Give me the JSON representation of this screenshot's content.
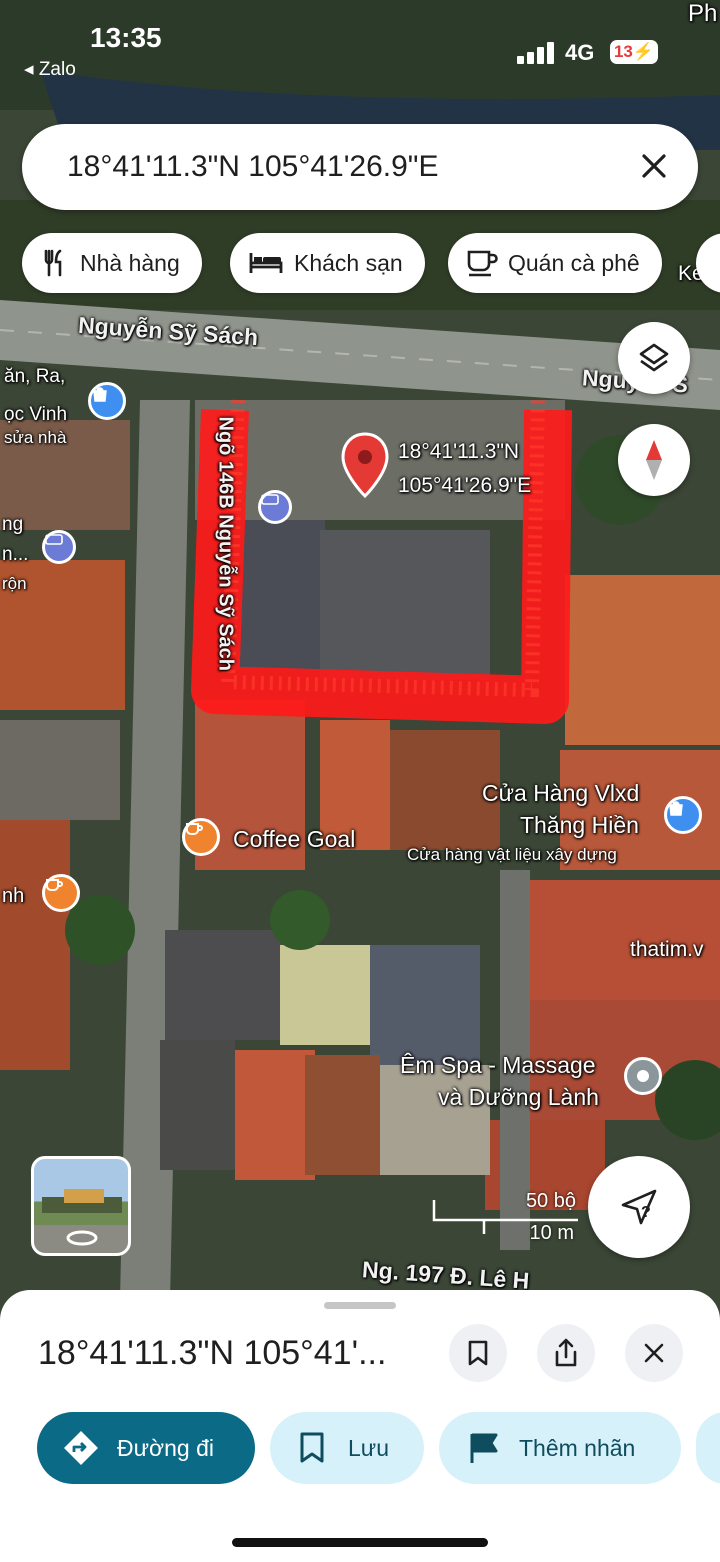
{
  "status_bar": {
    "time": "13:35",
    "back_app": "◂ Zalo",
    "network": "4G",
    "battery": "13",
    "battery_icon": "charging-battery-icon"
  },
  "search": {
    "query": "18°41'11.3\"N 105°41'26.9\"E",
    "clear_icon": "close-icon"
  },
  "chips": [
    {
      "label": "Nhà hàng",
      "icon": "restaurant-icon"
    },
    {
      "label": "Khách sạn",
      "icon": "hotel-bed-icon"
    },
    {
      "label": "Quán cà phê",
      "icon": "coffee-cup-icon"
    }
  ],
  "map": {
    "top_right_text": "Ph",
    "streets": {
      "main": "Nguyễn Sỹ Sách",
      "main_right": "Nguyễn S",
      "alley": "Ngõ 146B Nguyễn Sỹ Sách",
      "bottom": "Ng. 197 Đ. Lê H"
    },
    "pin": {
      "lat": "18°41'11.3\"N",
      "lng": "105°41'26.9\"E",
      "color": "#e53935"
    },
    "left_labels": [
      "ăn, Ra,",
      "ọc Vinh",
      "sửa nhà",
      "ng",
      "n...",
      "rộn",
      "nh"
    ],
    "pois": [
      {
        "name": "Coffee Goal",
        "type": "cafe"
      },
      {
        "name": "Cửa Hàng Vlxd",
        "name2": "Thăng Hiền",
        "subtitle": "Cửa hàng vật liệu xây dựng",
        "type": "shop"
      },
      {
        "name": "Êm Spa - Massage",
        "name2": "và Dưỡng Lành",
        "type": "place"
      }
    ],
    "right_labels": {
      "ke": "Ke",
      "thatim": "thatim.v"
    },
    "scale": {
      "imperial": "50 bộ",
      "metric": "10 m"
    },
    "highlight_color": "#ff1a1a"
  },
  "controls": {
    "layers_icon": "layers-icon",
    "compass_icon": "compass-icon",
    "locate_icon": "my-location-unknown-icon",
    "street_view_icon": "street-view-rotate-icon"
  },
  "sheet": {
    "title": "18°41'11.3\"N 105°41'...",
    "save_icon": "bookmark-icon",
    "share_icon": "share-icon",
    "close_icon": "close-icon",
    "actions": [
      {
        "label": "Đường đi",
        "icon": "directions-icon"
      },
      {
        "label": "Lưu",
        "icon": "bookmark-icon"
      },
      {
        "label": "Thêm nhãn",
        "icon": "flag-icon"
      }
    ]
  }
}
